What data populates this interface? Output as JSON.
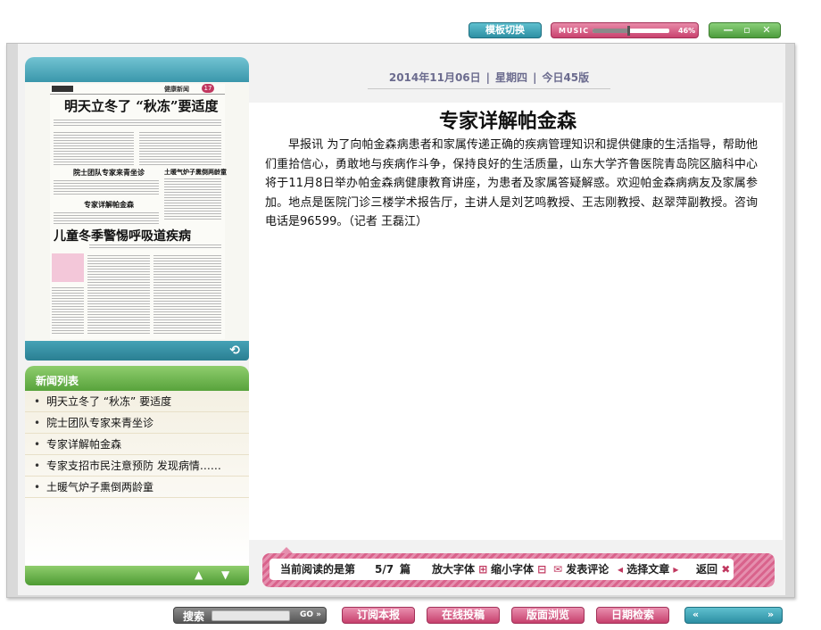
{
  "topbar": {
    "template_switch": "模板切换",
    "music_label": "MUSIC",
    "music_volume_pct": 46,
    "music_volume_text": "46%",
    "window_controls": {
      "minimize": "—",
      "maximize": "▫",
      "close": "✕"
    }
  },
  "thumbnail": {
    "headline_1": "明天立冬了 “秋冻”要适度",
    "headline_2": "院士团队专家来青坐诊",
    "headline_3": "土暖气炉子熏倒两龄童",
    "headline_4": "专家详解帕金森",
    "headline_5": "儿童冬季警惕呼吸道疾病",
    "masthead_right": "健康新闻",
    "page_num": "17",
    "refresh_icon": "refresh-icon"
  },
  "news_list": {
    "title": "新闻列表",
    "items": [
      "明天立冬了 “秋冻” 要适度",
      "院士团队专家来青坐诊",
      "专家详解帕金森",
      "专家支招市民注意预防 发现病情……",
      "土暖气炉子熏倒两龄童"
    ],
    "up_icon": "▲",
    "down_icon": "▼"
  },
  "dateline": {
    "date": "2014年11月06日",
    "weekday": "星期四",
    "edition": "今日45版"
  },
  "article": {
    "title": "专家详解帕金森",
    "body": "早报讯 为了向帕金森病患者和家属传递正确的疾病管理知识和提供健康的生活指导，帮助他们重拾信心，勇敢地与疾病作斗争，保持良好的生活质量，山东大学齐鲁医院青岛院区脑科中心将于11月8日举办帕金森病健康教育讲座，为患者及家属答疑解惑。欢迎帕金森病病友及家属参加。地点是医院门诊三楼学术报告厅，主讲人是刘艺鸣教授、王志刚教授、赵翠萍副教授。咨询电话是96599。（记者 王磊江）"
  },
  "reading_bar": {
    "current_label": "当前阅读的是第",
    "current_value": "5/7",
    "unit": "篇",
    "zoom_in": "放大字体",
    "zoom_out": "缩小字体",
    "comment": "发表评论",
    "select": "选择文章",
    "back": "返回"
  },
  "bottom_bar": {
    "search_label": "搜索",
    "search_value": "",
    "go": "GO",
    "subscribe": "订阅本报",
    "submit": "在线投稿",
    "browse": "版面浏览",
    "date_search": "日期检索",
    "prev": "«",
    "next": "»"
  }
}
